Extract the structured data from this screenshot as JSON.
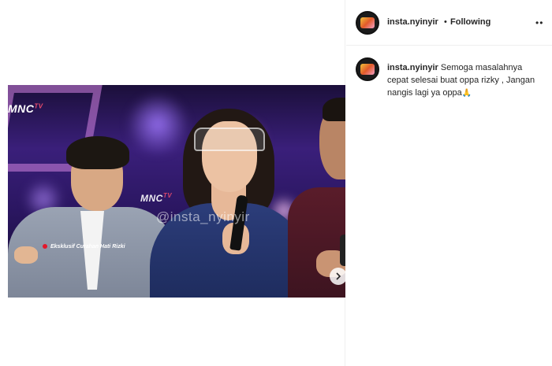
{
  "header": {
    "username": "insta.nyinyir",
    "separator": "•",
    "follow_status": "Following",
    "more_icon": "more-horizontal-icon"
  },
  "caption": {
    "username": "insta.nyinyir",
    "text": "Semoga masalahnya cepat selesai buat oppa rizky , Jangan nangis lagi ya oppa",
    "emoji": "🙏"
  },
  "media": {
    "channel_logo": "MNC",
    "channel_logo_suffix": "TV",
    "watermark": "@insta_nyinyir",
    "news_ticker": "Eksklusif Curahan Hati Rizki",
    "next_icon": "chevron-right-icon"
  },
  "colors": {
    "border": "#efefef",
    "text": "#262626",
    "stage_purple": "#3a1f7a",
    "ticker_red": "#e3172b"
  }
}
